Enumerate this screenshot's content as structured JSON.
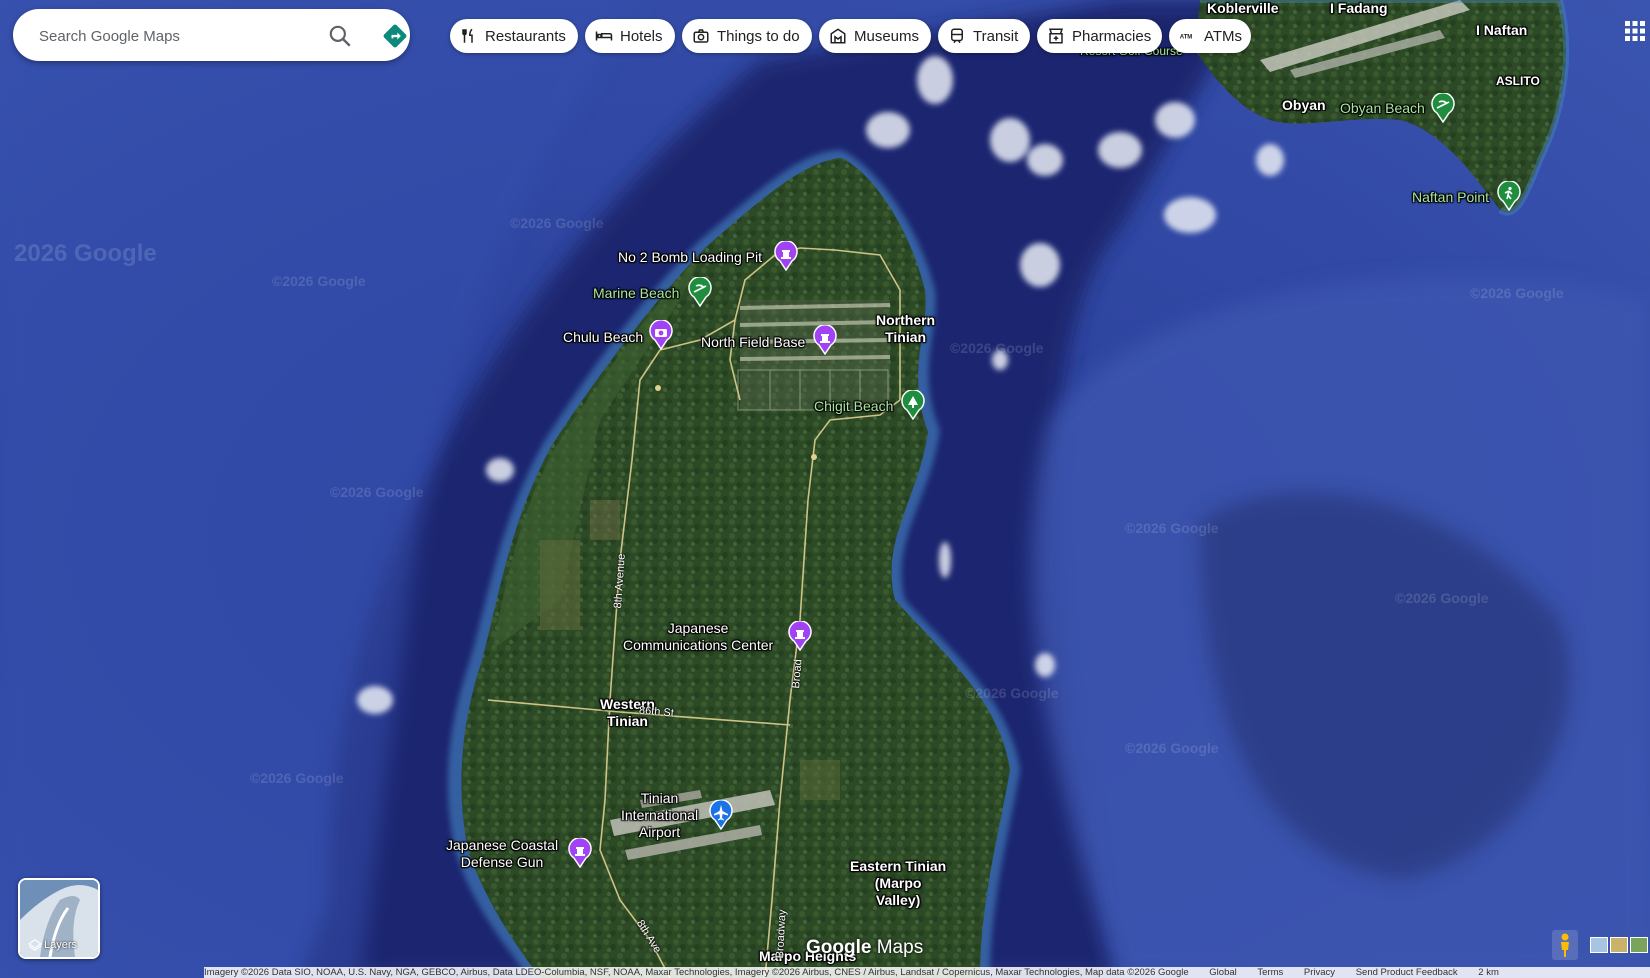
{
  "search": {
    "placeholder": "Search Google Maps"
  },
  "chips": [
    {
      "label": "Restaurants",
      "icon": "fork-knife-icon"
    },
    {
      "label": "Hotels",
      "icon": "bed-icon"
    },
    {
      "label": "Things to do",
      "icon": "camera-icon"
    },
    {
      "label": "Museums",
      "icon": "museum-icon"
    },
    {
      "label": "Transit",
      "icon": "train-icon"
    },
    {
      "label": "Pharmacies",
      "icon": "pharmacy-icon"
    },
    {
      "label": "ATMs",
      "icon": "atm-icon"
    }
  ],
  "places": {
    "koblerville": "Koblerville",
    "i_fadang": "I Fadang",
    "i_naftan": "I Naftan",
    "aslito": "ASLITO",
    "obyan": "Obyan",
    "obyan_beach": "Obyan Beach",
    "naftan_point": "Naftan Point",
    "resort_golf": "Resort Golf Course",
    "no2_bomb": "No 2 Bomb Loading Pit",
    "marine_beach": "Marine Beach",
    "chulu_beach": "Chulu Beach",
    "north_field": "North Field Base",
    "northern_tinian_1": "Northern",
    "northern_tinian_2": "Tinian",
    "chigit_beach": "Chigit Beach",
    "japanese_comm_1": "Japanese",
    "japanese_comm_2": "Communications Center",
    "western_tinian_1": "Western",
    "western_tinian_2": "Tinian",
    "airport_1": "Tinian",
    "airport_2": "International",
    "airport_3": "Airport",
    "coastal_gun_1": "Japanese Coastal",
    "coastal_gun_2": "Defense Gun",
    "eastern_tinian_1": "Eastern Tinian",
    "eastern_tinian_2": "(Marpo",
    "eastern_tinian_3": "Valley)",
    "marpo_heights": "Marpo Heights"
  },
  "roads": {
    "eighth_avenue": "8th Avenue",
    "eighty_sixth": "86th St",
    "broadway": "Broad",
    "eighth_ave": "8th Ave",
    "broadway_south": "Broadway"
  },
  "watermark": "©2026 Google",
  "watermark_large": "2026 Google",
  "layers": {
    "label": "Layers"
  },
  "logo": {
    "brand": "Google",
    "product": "Maps"
  },
  "footer": {
    "attribution": "Imagery ©2026 Data SIO, NOAA, U.S. Navy, NGA, GEBCO, Airbus, Data LDEO-Columbia, NSF, NOAA, Maxar Technologies, Imagery ©2026 Airbus, CNES / Airbus, Landsat / Copernicus, Maxar Technologies, Map data ©2026 Google",
    "global": "Global",
    "terms": "Terms",
    "privacy": "Privacy",
    "feedback": "Send Product Feedback",
    "scale": "2 km"
  },
  "colors": {
    "ocean_deep": "#1c2b6e",
    "ocean_shallow": "#3a50a8",
    "land": "#2f4a28",
    "road": "#d9c88a",
    "poi_purple": "#a142f4",
    "poi_green": "#1e8e3e",
    "poi_blue": "#1a73e8"
  }
}
